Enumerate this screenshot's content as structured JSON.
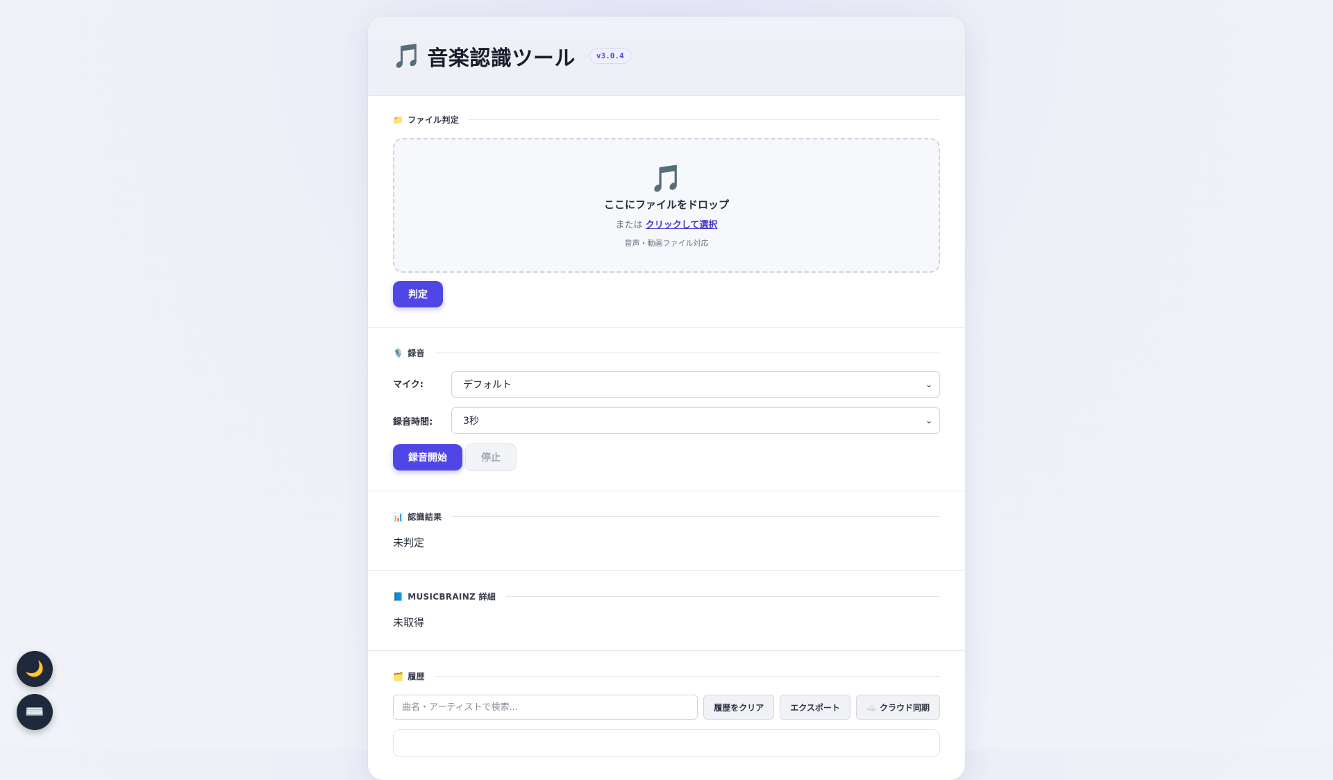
{
  "app": {
    "title_icon": "🎵",
    "title": "音楽認識ツール",
    "version": "v3.0.4"
  },
  "file_section": {
    "icon": "📁",
    "heading": "ファイル判定",
    "dropzone": {
      "icon": "🎵",
      "title": "ここにファイルをドロップ",
      "or_text": "または",
      "link_text": "クリックして選択",
      "note": "音声・動画ファイル対応"
    },
    "judge_label": "判定"
  },
  "record_section": {
    "icon": "🎙️",
    "heading": "録音",
    "mic_label": "マイク:",
    "mic_value": "デフォルト",
    "duration_label": "録音時間:",
    "duration_value": "3秒",
    "start_label": "録音開始",
    "stop_label": "停止"
  },
  "result_section": {
    "icon": "📊",
    "heading": "認識結果",
    "value": "未判定"
  },
  "musicbrainz_section": {
    "icon": "📘",
    "heading": "MUSICBRAINZ 詳細",
    "value": "未取得"
  },
  "history_section": {
    "icon": "🗂️",
    "heading": "履歴",
    "search_placeholder": "曲名・アーティストで検索...",
    "clear_label": "履歴をクリア",
    "export_label": "エクスポート",
    "cloud_label": "☁️ クラウド同期"
  },
  "floating": {
    "theme_icon": "🌙",
    "keyboard_icon": "⌨️"
  },
  "colors": {
    "accent": "#4f46e5",
    "fab_bg": "#1e293b"
  }
}
